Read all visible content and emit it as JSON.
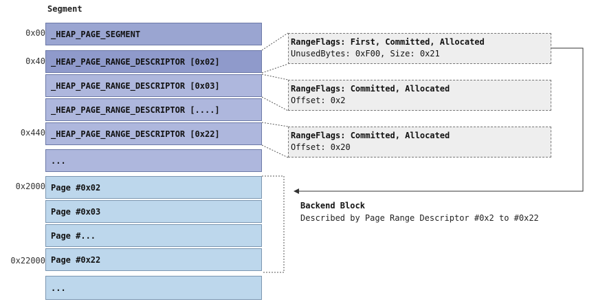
{
  "title": "Segment",
  "segment_rows": [
    {
      "addr": "0x00",
      "label": "_HEAP_PAGE_SEGMENT"
    },
    {
      "addr": "0x40",
      "label": "_HEAP_PAGE_RANGE_DESCRIPTOR [0x02]"
    },
    {
      "addr": "",
      "label": "_HEAP_PAGE_RANGE_DESCRIPTOR [0x03]"
    },
    {
      "addr": "",
      "label": "_HEAP_PAGE_RANGE_DESCRIPTOR [....]"
    },
    {
      "addr": "0x440",
      "label": "_HEAP_PAGE_RANGE_DESCRIPTOR [0x22]"
    },
    {
      "addr": "",
      "label": "..."
    }
  ],
  "page_rows": [
    {
      "addr": "0x2000",
      "label": "Page #0x02"
    },
    {
      "addr": "",
      "label": "Page #0x03"
    },
    {
      "addr": "",
      "label": "Page #..."
    },
    {
      "addr": "0x22000",
      "label": "Page #0x22"
    },
    {
      "addr": "",
      "label": "..."
    }
  ],
  "descriptor_details": [
    {
      "line1": "RangeFlags: First, Committed, Allocated",
      "line2": "UnusedBytes: 0xF00, Size: 0x21"
    },
    {
      "line1": "RangeFlags: Committed, Allocated",
      "line2": "Offset: 0x2"
    },
    {
      "line1": "RangeFlags: Committed, Allocated",
      "line2": "Offset: 0x20"
    }
  ],
  "backend_block": {
    "title": "Backend Block",
    "description": "Described by Page Range Descriptor #0x2 to #0x22"
  },
  "colors": {
    "segment_box": "#aeb7dd",
    "page_box": "#bdd7ec",
    "detail_box": "#eeeeee",
    "connector": "#555555"
  }
}
